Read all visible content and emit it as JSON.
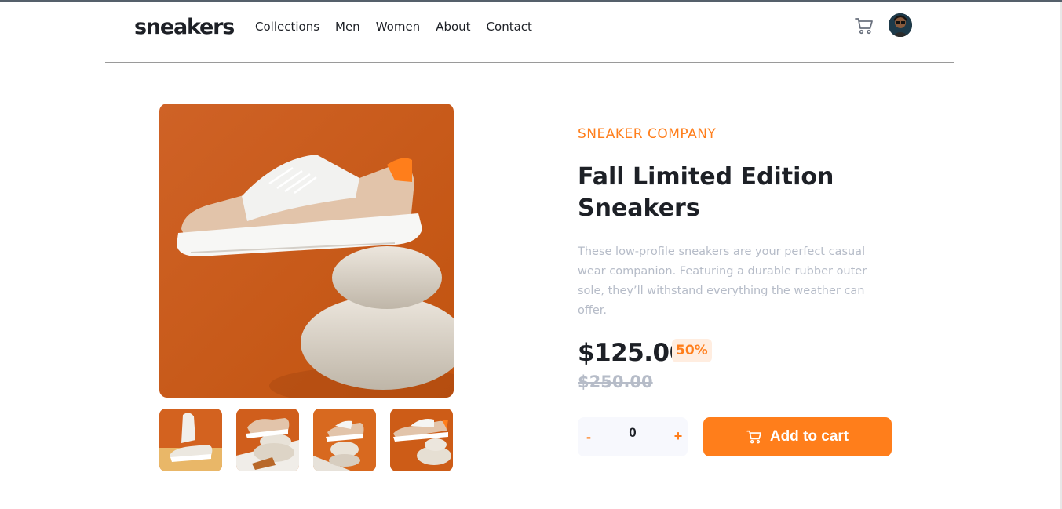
{
  "header": {
    "logo": "sneakers",
    "nav": [
      "Collections",
      "Men",
      "Women",
      "About",
      "Contact"
    ]
  },
  "product": {
    "company": "SNEAKER COMPANY",
    "title": "Fall Limited Edition Sneakers",
    "description": "These low-profile sneakers are your perfect casual wear companion. Featuring a durable rubber outer sole, they’ll withstand everything the weather can offer.",
    "price": "$125.00",
    "discount": "50%",
    "original_price": "$250.00"
  },
  "cart": {
    "minus": "-",
    "quantity": "0",
    "plus": "+",
    "add_label": "Add to cart"
  },
  "colors": {
    "accent": "#ff7e1b",
    "dark": "#1d2026",
    "muted": "#b6bcc8",
    "badge_bg": "#ffede0",
    "qty_bg": "#f7f8fd"
  }
}
